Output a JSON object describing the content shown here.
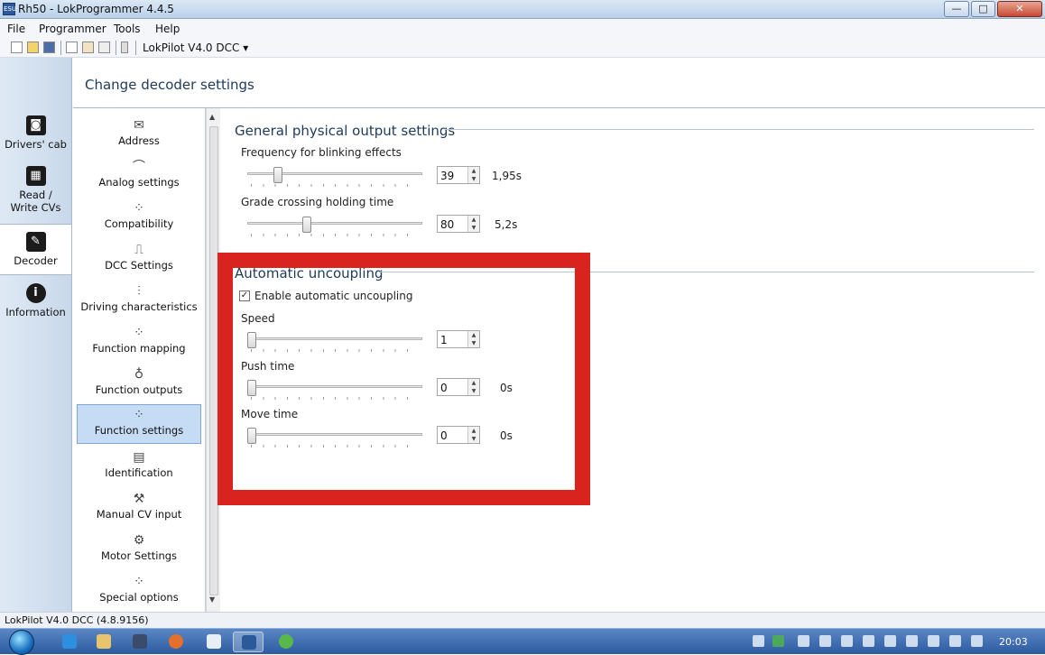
{
  "window": {
    "title": "Rh50 - LokProgrammer 4.4.5",
    "min_symbol": "—",
    "max_symbol": "□",
    "close_symbol": "✕"
  },
  "menu": [
    "File",
    "Programmer",
    "Tools",
    "Help"
  ],
  "toolbar": {
    "device": "LokPilot V4.0 DCC",
    "device_arrow": "▾"
  },
  "nav": [
    {
      "label": "Drivers' cab",
      "icon": "drivers-cab-icon",
      "glyph": "◙"
    },
    {
      "label": "Read / Write CVs",
      "icon": "read-write-cvs-icon",
      "glyph": "▦"
    },
    {
      "label": "Decoder",
      "icon": "decoder-icon",
      "glyph": "✎"
    },
    {
      "label": "Information",
      "icon": "information-icon",
      "glyph": "i"
    }
  ],
  "heading": "Change decoder settings",
  "categories": [
    {
      "label": "Address",
      "icon": "envelope-icon",
      "glyph": "✉"
    },
    {
      "label": "Analog settings",
      "icon": "analog-icon",
      "glyph": "⌒"
    },
    {
      "label": "Compatibility",
      "icon": "compatibility-icon",
      "glyph": "⁘"
    },
    {
      "label": "DCC Settings",
      "icon": "dcc-icon",
      "glyph": "⎍"
    },
    {
      "label": "Driving characteristics",
      "icon": "sliders-icon",
      "glyph": "⫶"
    },
    {
      "label": "Function mapping",
      "icon": "function-mapping-icon",
      "glyph": "⁘"
    },
    {
      "label": "Function outputs",
      "icon": "bulb-icon",
      "glyph": "♁"
    },
    {
      "label": "Function settings",
      "icon": "function-settings-icon",
      "glyph": "⁘"
    },
    {
      "label": "Identification",
      "icon": "id-card-icon",
      "glyph": "▤"
    },
    {
      "label": "Manual CV input",
      "icon": "wrench-icon",
      "glyph": "⚒"
    },
    {
      "label": "Motor Settings",
      "icon": "motor-icon",
      "glyph": "⚙"
    },
    {
      "label": "Special options",
      "icon": "special-options-icon",
      "glyph": "⁘"
    }
  ],
  "selected_category": "Function settings",
  "general": {
    "title": "General physical output settings",
    "blink": {
      "label": "Frequency for blinking effects",
      "value": "39",
      "unit": "1,95s",
      "level": 0.16
    },
    "grade": {
      "label": "Grade crossing holding time",
      "value": "80",
      "unit": "5,2s",
      "level": 0.33
    }
  },
  "uncoupling": {
    "title": "Automatic uncoupling",
    "enable_label": "Enable automatic uncoupling",
    "enabled": true,
    "check_mark": "✓",
    "speed": {
      "label": "Speed",
      "value": "1",
      "unit": "",
      "level": 0.0
    },
    "push": {
      "label": "Push time",
      "value": "0",
      "unit": "0s",
      "level": 0.0
    },
    "move": {
      "label": "Move time",
      "value": "0",
      "unit": "0s",
      "level": 0.0
    }
  },
  "status": "LokPilot V4.0 DCC (4.8.9156)",
  "clock": "20:03",
  "colors": {
    "highlight": "#d9231f",
    "accent": "#1e3a5a",
    "selection": "#c6dcf5"
  }
}
